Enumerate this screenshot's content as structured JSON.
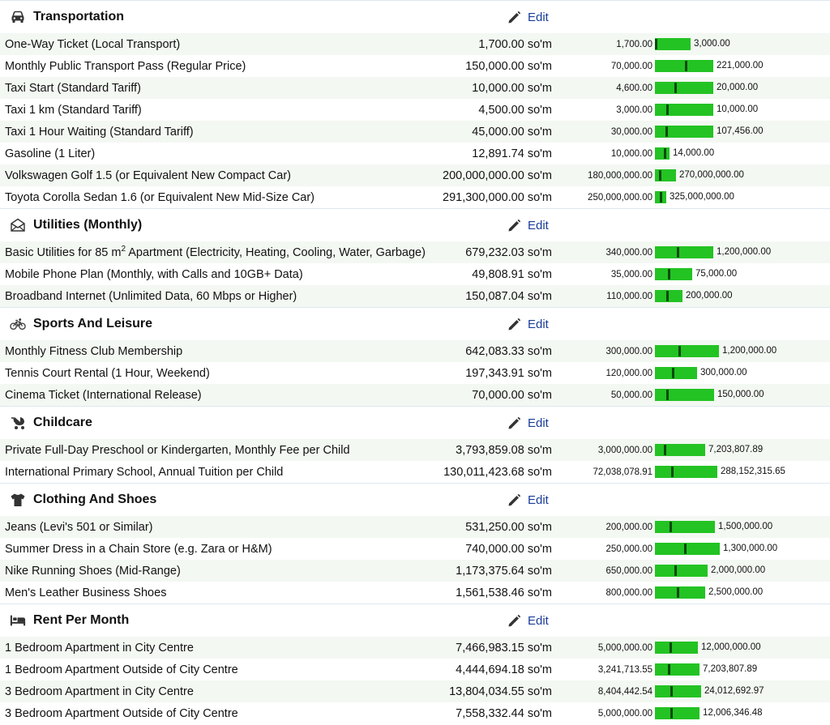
{
  "edit_label": "Edit",
  "colors": {
    "bar": "#23c323",
    "marker": "#0b4a0b",
    "link": "#1a3d9a",
    "stripe": "#f3f8f2"
  },
  "categories": [
    {
      "title": "Transportation",
      "icon": "car-icon",
      "items": [
        {
          "name": "One-Way Ticket (Local Transport)",
          "price": "1,700.00 so'm",
          "min": "1,700.00",
          "max": "3,000.00",
          "bar_frac": 0.0
        },
        {
          "name": "Monthly Public Transport Pass (Regular Price)",
          "price": "150,000.00 so'm",
          "min": "70,000.00",
          "max": "221,000.00",
          "bar_frac": 0.53
        },
        {
          "name": "Taxi Start (Standard Tariff)",
          "price": "10,000.00 so'm",
          "min": "4,600.00",
          "max": "20,000.00",
          "bar_frac": 0.35
        },
        {
          "name": "Taxi 1 km (Standard Tariff)",
          "price": "4,500.00 so'm",
          "min": "3,000.00",
          "max": "10,000.00",
          "bar_frac": 0.21
        },
        {
          "name": "Taxi 1 Hour Waiting (Standard Tariff)",
          "price": "45,000.00 so'm",
          "min": "30,000.00",
          "max": "107,456.00",
          "bar_frac": 0.19
        },
        {
          "name": "Gasoline (1 Liter)",
          "price": "12,891.74 so'm",
          "min": "10,000.00",
          "max": "14,000.00",
          "bar_frac": 0.72
        },
        {
          "name": "Volkswagen Golf 1.5 (or Equivalent New Compact Car)",
          "price": "200,000,000.00 so'm",
          "min": "180,000,000.00",
          "max": "270,000,000.00",
          "bar_frac": 0.22
        },
        {
          "name": "Toyota Corolla Sedan 1.6 (or Equivalent New Mid-Size Car)",
          "price": "291,300,000.00 so'm",
          "min": "250,000,000.00",
          "max": "325,000,000.00",
          "bar_frac": 0.55
        }
      ]
    },
    {
      "title": "Utilities (Monthly)",
      "icon": "envelope-icon",
      "items": [
        {
          "name_pre": "Basic Utilities for 85 m",
          "name_sup": "2",
          "name": " Apartment (Electricity, Heating, Cooling, Water, Garbage)",
          "price": "679,232.03 so'm",
          "min": "340,000.00",
          "max": "1,200,000.00",
          "bar_frac": 0.39
        },
        {
          "name": "Mobile Phone Plan (Monthly, with Calls and 10GB+ Data)",
          "price": "49,808.91 so'm",
          "min": "35,000.00",
          "max": "75,000.00",
          "bar_frac": 0.37
        },
        {
          "name": "Broadband Internet (Unlimited Data, 60 Mbps or Higher)",
          "price": "150,087.04 so'm",
          "min": "110,000.00",
          "max": "200,000.00",
          "bar_frac": 0.45
        }
      ]
    },
    {
      "title": "Sports And Leisure",
      "icon": "bicycle-icon",
      "items": [
        {
          "name": "Monthly Fitness Club Membership",
          "price": "642,083.33 so'm",
          "min": "300,000.00",
          "max": "1,200,000.00",
          "bar_frac": 0.38
        },
        {
          "name": "Tennis Court Rental (1 Hour, Weekend)",
          "price": "197,343.91 so'm",
          "min": "120,000.00",
          "max": "300,000.00",
          "bar_frac": 0.43
        },
        {
          "name": "Cinema Ticket (International Release)",
          "price": "70,000.00 so'm",
          "min": "50,000.00",
          "max": "150,000.00",
          "bar_frac": 0.2
        }
      ]
    },
    {
      "title": "Childcare",
      "icon": "stroller-icon",
      "items": [
        {
          "name": "Private Full-Day Preschool or Kindergarten, Monthly Fee per Child",
          "price": "3,793,859.08 so'm",
          "min": "3,000,000.00",
          "max": "7,203,807.89",
          "bar_frac": 0.19
        },
        {
          "name": "International Primary School, Annual Tuition per Child",
          "price": "130,011,423.68 so'm",
          "min": "72,038,078.91",
          "max": "288,152,315.65",
          "bar_frac": 0.27
        }
      ]
    },
    {
      "title": "Clothing And Shoes",
      "icon": "tshirt-icon",
      "items": [
        {
          "name": "Jeans (Levi's 501 or Similar)",
          "price": "531,250.00 so'm",
          "min": "200,000.00",
          "max": "1,500,000.00",
          "bar_frac": 0.25
        },
        {
          "name": "Summer Dress in a Chain Store (e.g. Zara or H&M)",
          "price": "740,000.00 so'm",
          "min": "250,000.00",
          "max": "1,300,000.00",
          "bar_frac": 0.47
        },
        {
          "name": "Nike Running Shoes (Mid-Range)",
          "price": "1,173,375.64 so'm",
          "min": "650,000.00",
          "max": "2,000,000.00",
          "bar_frac": 0.39
        },
        {
          "name": "Men's Leather Business Shoes",
          "price": "1,561,538.46 so'm",
          "min": "800,000.00",
          "max": "2,500,000.00",
          "bar_frac": 0.45
        }
      ]
    },
    {
      "title": "Rent Per Month",
      "icon": "bed-icon",
      "items": [
        {
          "name": "1 Bedroom Apartment in City Centre",
          "price": "7,466,983.15 so'm",
          "min": "5,000,000.00",
          "max": "12,000,000.00",
          "bar_frac": 0.35
        },
        {
          "name": "1 Bedroom Apartment Outside of City Centre",
          "price": "4,444,694.18 so'm",
          "min": "3,241,713.55",
          "max": "7,203,807.89",
          "bar_frac": 0.3
        },
        {
          "name": "3 Bedroom Apartment in City Centre",
          "price": "13,804,034.55 so'm",
          "min": "8,404,442.54",
          "max": "24,012,692.97",
          "bar_frac": 0.35
        },
        {
          "name": "3 Bedroom Apartment Outside of City Centre",
          "price": "7,558,332.44 so'm",
          "min": "5,000,000.00",
          "max": "12,006,346.48",
          "bar_frac": 0.36
        }
      ]
    }
  ]
}
